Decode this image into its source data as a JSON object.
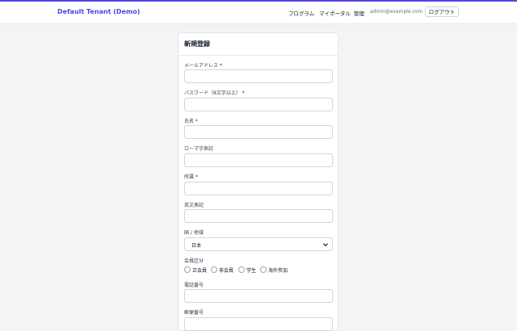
{
  "header": {
    "brand": "Default Tenant (Demo)",
    "nav": [
      "プログラム",
      "マイポータル",
      "管理"
    ],
    "email": "admin@example.com",
    "logout": "ログアウト"
  },
  "form": {
    "title": "新規登録",
    "fields": {
      "email": "メールアドレス *",
      "password": "パスワード（8文字以上） *",
      "name": "氏名 *",
      "romaji": "ローマ字表記",
      "affiliation": "所属 *",
      "english": "英文表記",
      "country": "国 / 地域",
      "member_type": "会員区分",
      "phone": "電話番号",
      "postal": "郵便番号"
    },
    "country_value": "日本",
    "member_options": [
      "正会員",
      "非会員",
      "学生",
      "海外参加"
    ]
  },
  "colors": {
    "accent": "#4f46e5",
    "background": "#f3f4f6"
  }
}
